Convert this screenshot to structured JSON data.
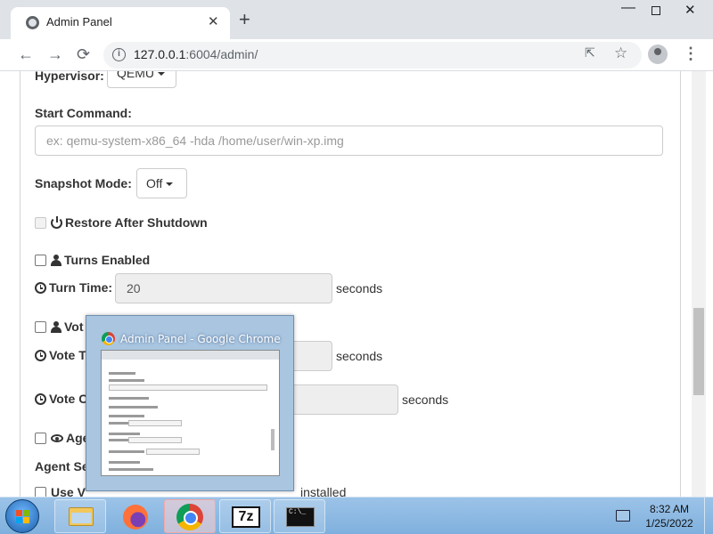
{
  "browser": {
    "tab_title": "Admin Panel",
    "tab_close": "✕",
    "new_tab": "+",
    "url_host": "127.0.0.1",
    "url_rest": ":6004/admin/",
    "window_controls": {
      "minimize": "—",
      "close": "✕"
    },
    "nav": {
      "back": "←",
      "forward": "→",
      "reload": "⟳"
    },
    "toolbar_icons": {
      "share": "⇱",
      "star": "☆",
      "menu": "⋮"
    }
  },
  "form": {
    "hypervisor": {
      "label": "Hypervisor:",
      "value": "QEMU"
    },
    "start_command": {
      "label": "Start Command:",
      "placeholder": "ex: qemu-system-x86_64 -hda /home/user/win-xp.img"
    },
    "snapshot_mode": {
      "label": "Snapshot Mode:",
      "value": "Off"
    },
    "restore_after_shutdown": {
      "label": "Restore After Shutdown",
      "checked": false,
      "disabled": true
    },
    "turns_enabled": {
      "label": "Turns Enabled",
      "checked": false
    },
    "turn_time": {
      "label": "Turn Time:",
      "value": "20",
      "unit": "seconds"
    },
    "votes_enabled": {
      "label_visible": "Vot",
      "checked": false
    },
    "vote_time": {
      "label_visible": "Vote T",
      "unit": "seconds"
    },
    "vote_cooldown": {
      "label_visible": "Vote C",
      "unit": "seconds"
    },
    "agent": {
      "label_visible": "Age",
      "checked": false
    },
    "agent_settings_heading": {
      "label_visible": "Agent Se"
    },
    "bottom_partial": {
      "left_visible": "Use V",
      "right_visible": "installed"
    }
  },
  "preview": {
    "title": "Admin Panel - Google Chrome"
  },
  "taskbar": {
    "apps": [
      "file-explorer",
      "firefox",
      "chrome",
      "7-zip",
      "command-prompt"
    ],
    "seven_zip_label": "7z",
    "cmd_label": "C:\\_",
    "time": "8:32 AM",
    "date": "1/25/2022"
  }
}
